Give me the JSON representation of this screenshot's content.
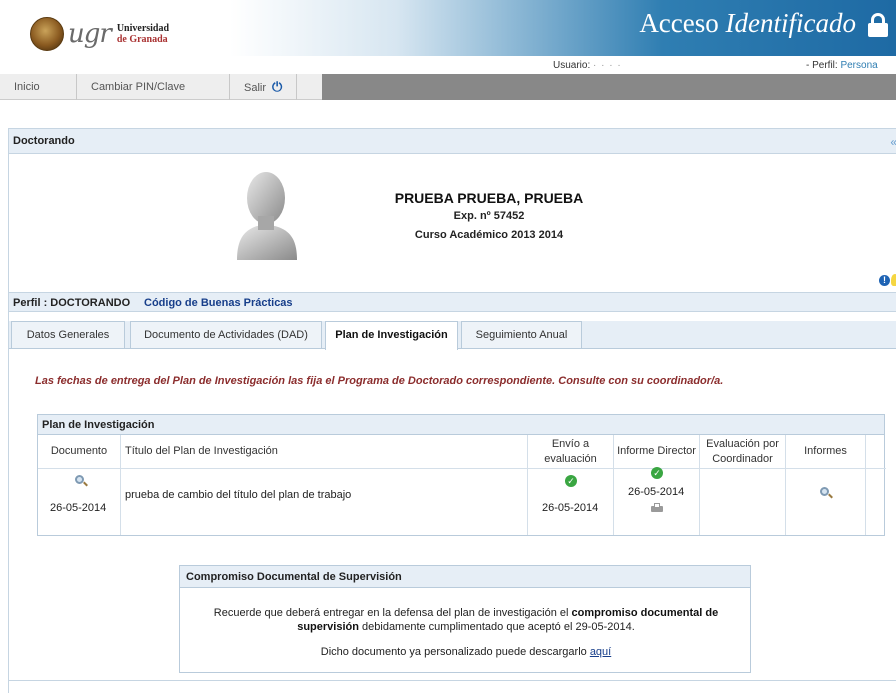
{
  "header": {
    "logo_text": "ugr",
    "univ_line1": "Universidad",
    "univ_line2": "de Granada",
    "banner_title_plain": "Acceso ",
    "banner_title_italic": "Identificado",
    "usuario_label": "Usuario:",
    "usuario_value": "· · · ·",
    "perfil_label": "- Perfil:",
    "perfil_value": "Persona"
  },
  "nav": {
    "inicio": "Inicio",
    "cambiar_pin": "Cambiar PIN/Clave",
    "salir": "Salir",
    "power_icon": "⏻"
  },
  "panel": {
    "title": "Doctorando",
    "expand_icon": "«"
  },
  "person": {
    "name": "PRUEBA PRUEBA, PRUEBA",
    "expediente": "Exp. nº 57452",
    "curso": "Curso Académico 2013 2014"
  },
  "perfil_bar": {
    "perfil": "Perfil : DOCTORANDO",
    "codigo": "Código de Buenas Prácticas"
  },
  "tabs": [
    {
      "label": "Datos Generales"
    },
    {
      "label": "Documento de Actividades (DAD)"
    },
    {
      "label": "Plan de Investigación"
    },
    {
      "label": "Seguimiento Anual"
    }
  ],
  "notice": "Las fechas de entrega del Plan de Investigación las fija el Programa de Doctorado correspondiente. Consulte con su coordinador/a.",
  "plan_table": {
    "title": "Plan de Investigación",
    "columns": [
      "Documento",
      "Título del Plan de Investigación",
      "Envío a evaluación",
      "Informe Director",
      "Evaluación por Coordinador",
      "Informes"
    ],
    "row": {
      "documento_date": "26-05-2014",
      "titulo": "prueba de cambio del título del plan de trabajo",
      "envio_date": "26-05-2014",
      "informe_date": "26-05-2014"
    }
  },
  "compromiso": {
    "title": "Compromiso Documental de Supervisión",
    "text_before": "Recuerde que deberá entregar en la defensa del plan de investigación el ",
    "text_bold": "compromiso documental de supervisión",
    "text_after": " debidamente cumplimentado que aceptó el 29-05-2014.",
    "download_text": "Dicho documento ya personalizado puede descargarlo ",
    "download_link": "aquí"
  },
  "colors": {
    "accent": "#2f7eb2",
    "notice": "#8b2d2d",
    "link": "#173e8a",
    "check": "#3aa642"
  }
}
